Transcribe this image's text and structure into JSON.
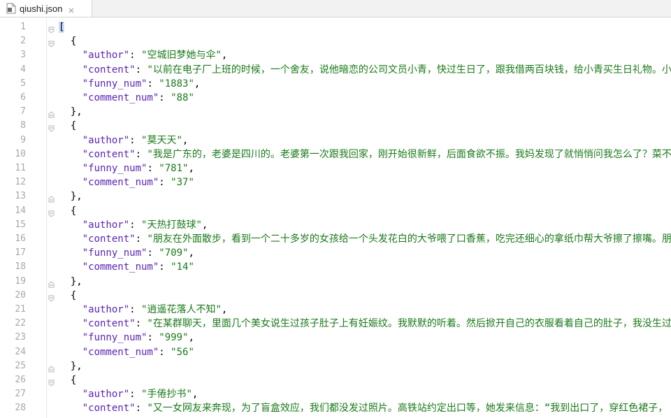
{
  "tab": {
    "filename": "qiushi.json"
  },
  "editor": {
    "lines": [
      {
        "n": "1",
        "text": "["
      },
      {
        "n": "2",
        "text": "  {"
      },
      {
        "n": "3",
        "text": "    \"author\": \"空城旧梦她与伞\","
      },
      {
        "n": "4",
        "text": "    \"content\": \"以前在电子厂上班的时候，一个舍友，说他暗恋的公司文员小青，快过生日了，跟我借两百块钱，给小青买生日礼物。小"
      },
      {
        "n": "5",
        "text": "    \"funny_num\": \"1883\","
      },
      {
        "n": "6",
        "text": "    \"comment_num\": \"88\""
      },
      {
        "n": "7",
        "text": "  },"
      },
      {
        "n": "8",
        "text": "  {"
      },
      {
        "n": "9",
        "text": "    \"author\": \"莫天天\","
      },
      {
        "n": "10",
        "text": "    \"content\": \"我是广东的，老婆是四川的。老婆第一次跟我回家，刚开始很新鲜，后面食欲不振。我妈发现了就悄悄问我怎么了？菜不"
      },
      {
        "n": "11",
        "text": "    \"funny_num\": \"781\","
      },
      {
        "n": "12",
        "text": "    \"comment_num\": \"37\""
      },
      {
        "n": "13",
        "text": "  },"
      },
      {
        "n": "14",
        "text": "  {"
      },
      {
        "n": "15",
        "text": "    \"author\": \"天热打鼓球\","
      },
      {
        "n": "16",
        "text": "    \"content\": \"朋友在外面散步，看到一个二十多岁的女孩给一个头发花白的大爷喂了口香蕉，吃完还细心的拿纸巾帮大爷擦了擦嘴。朋"
      },
      {
        "n": "17",
        "text": "    \"funny_num\": \"709\","
      },
      {
        "n": "18",
        "text": "    \"comment_num\": \"14\""
      },
      {
        "n": "19",
        "text": "  },"
      },
      {
        "n": "20",
        "text": "  {"
      },
      {
        "n": "21",
        "text": "    \"author\": \"逍遥花落人不知\","
      },
      {
        "n": "22",
        "text": "    \"content\": \"在某群聊天，里面几个美女说生过孩子肚子上有妊娠纹。我默默的听着。然后掀开自己的衣服看着自己的肚子，我没生过"
      },
      {
        "n": "23",
        "text": "    \"funny_num\": \"999\","
      },
      {
        "n": "24",
        "text": "    \"comment_num\": \"56\""
      },
      {
        "n": "25",
        "text": "  },"
      },
      {
        "n": "26",
        "text": "  {"
      },
      {
        "n": "27",
        "text": "    \"author\": \"手倦抄书\","
      },
      {
        "n": "28",
        "text": "    \"content\": \"又一女网友来奔现，为了盲盒效应，我们都没发过照片。高铁站约定出口等，她发来信息：“我到出口了，穿红色裙子，"
      }
    ]
  },
  "colors": {
    "key": "#5a25b8",
    "string": "#1a7a1a",
    "gutter_text": "#a8a8a8",
    "bracket_highlight": "#c9dfff"
  },
  "icons": {
    "tab_file": "json-file-icon",
    "tab_close": "close-icon",
    "fold": "fold-marker-icon"
  }
}
